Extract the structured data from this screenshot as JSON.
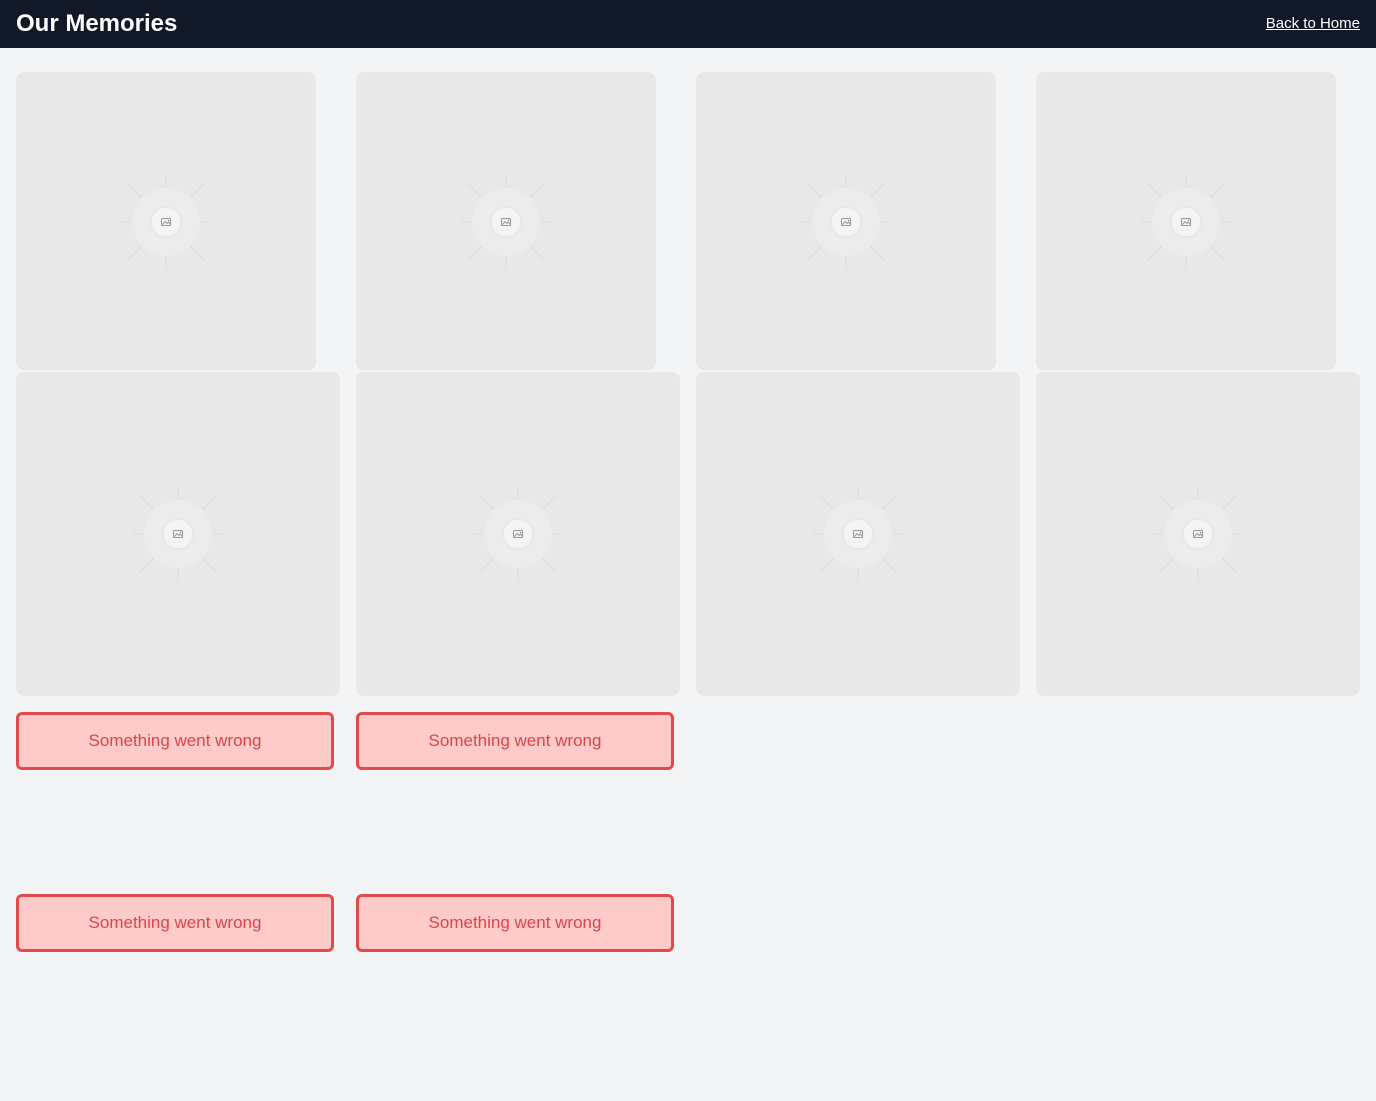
{
  "header": {
    "title": "Our Memories",
    "back_link": "Back to Home"
  },
  "gallery": {
    "image_icon": "image-placeholder-icon",
    "tile_count": 8,
    "errors": [
      {
        "message": "Something went wrong"
      },
      {
        "message": "Something went wrong"
      },
      {
        "message": "Something went wrong"
      },
      {
        "message": "Something went wrong"
      }
    ]
  },
  "colors": {
    "header_bg": "#111827",
    "page_bg": "#f3f4f6",
    "tile_bg": "#e8e8e8",
    "error_bg": "#fecaca",
    "error_border": "#e24b4b",
    "error_text": "#dc4646"
  }
}
